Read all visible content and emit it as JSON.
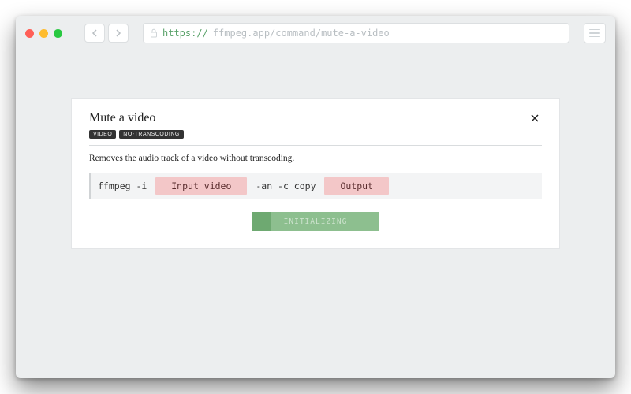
{
  "browser": {
    "url_scheme": "https://",
    "url_rest": "ffmpeg.app/command/mute-a-video"
  },
  "card": {
    "title": "Mute a video",
    "tags": [
      "VIDEO",
      "NO-TRANSCODING"
    ],
    "description": "Removes the audio track of a video without transcoding.",
    "command": {
      "prefix": "ffmpeg -i ",
      "slot1": "Input video",
      "middle": " -an -c copy ",
      "slot2": "Output"
    },
    "button": {
      "label": "INITIALIZING",
      "progress_pct": 15
    }
  }
}
